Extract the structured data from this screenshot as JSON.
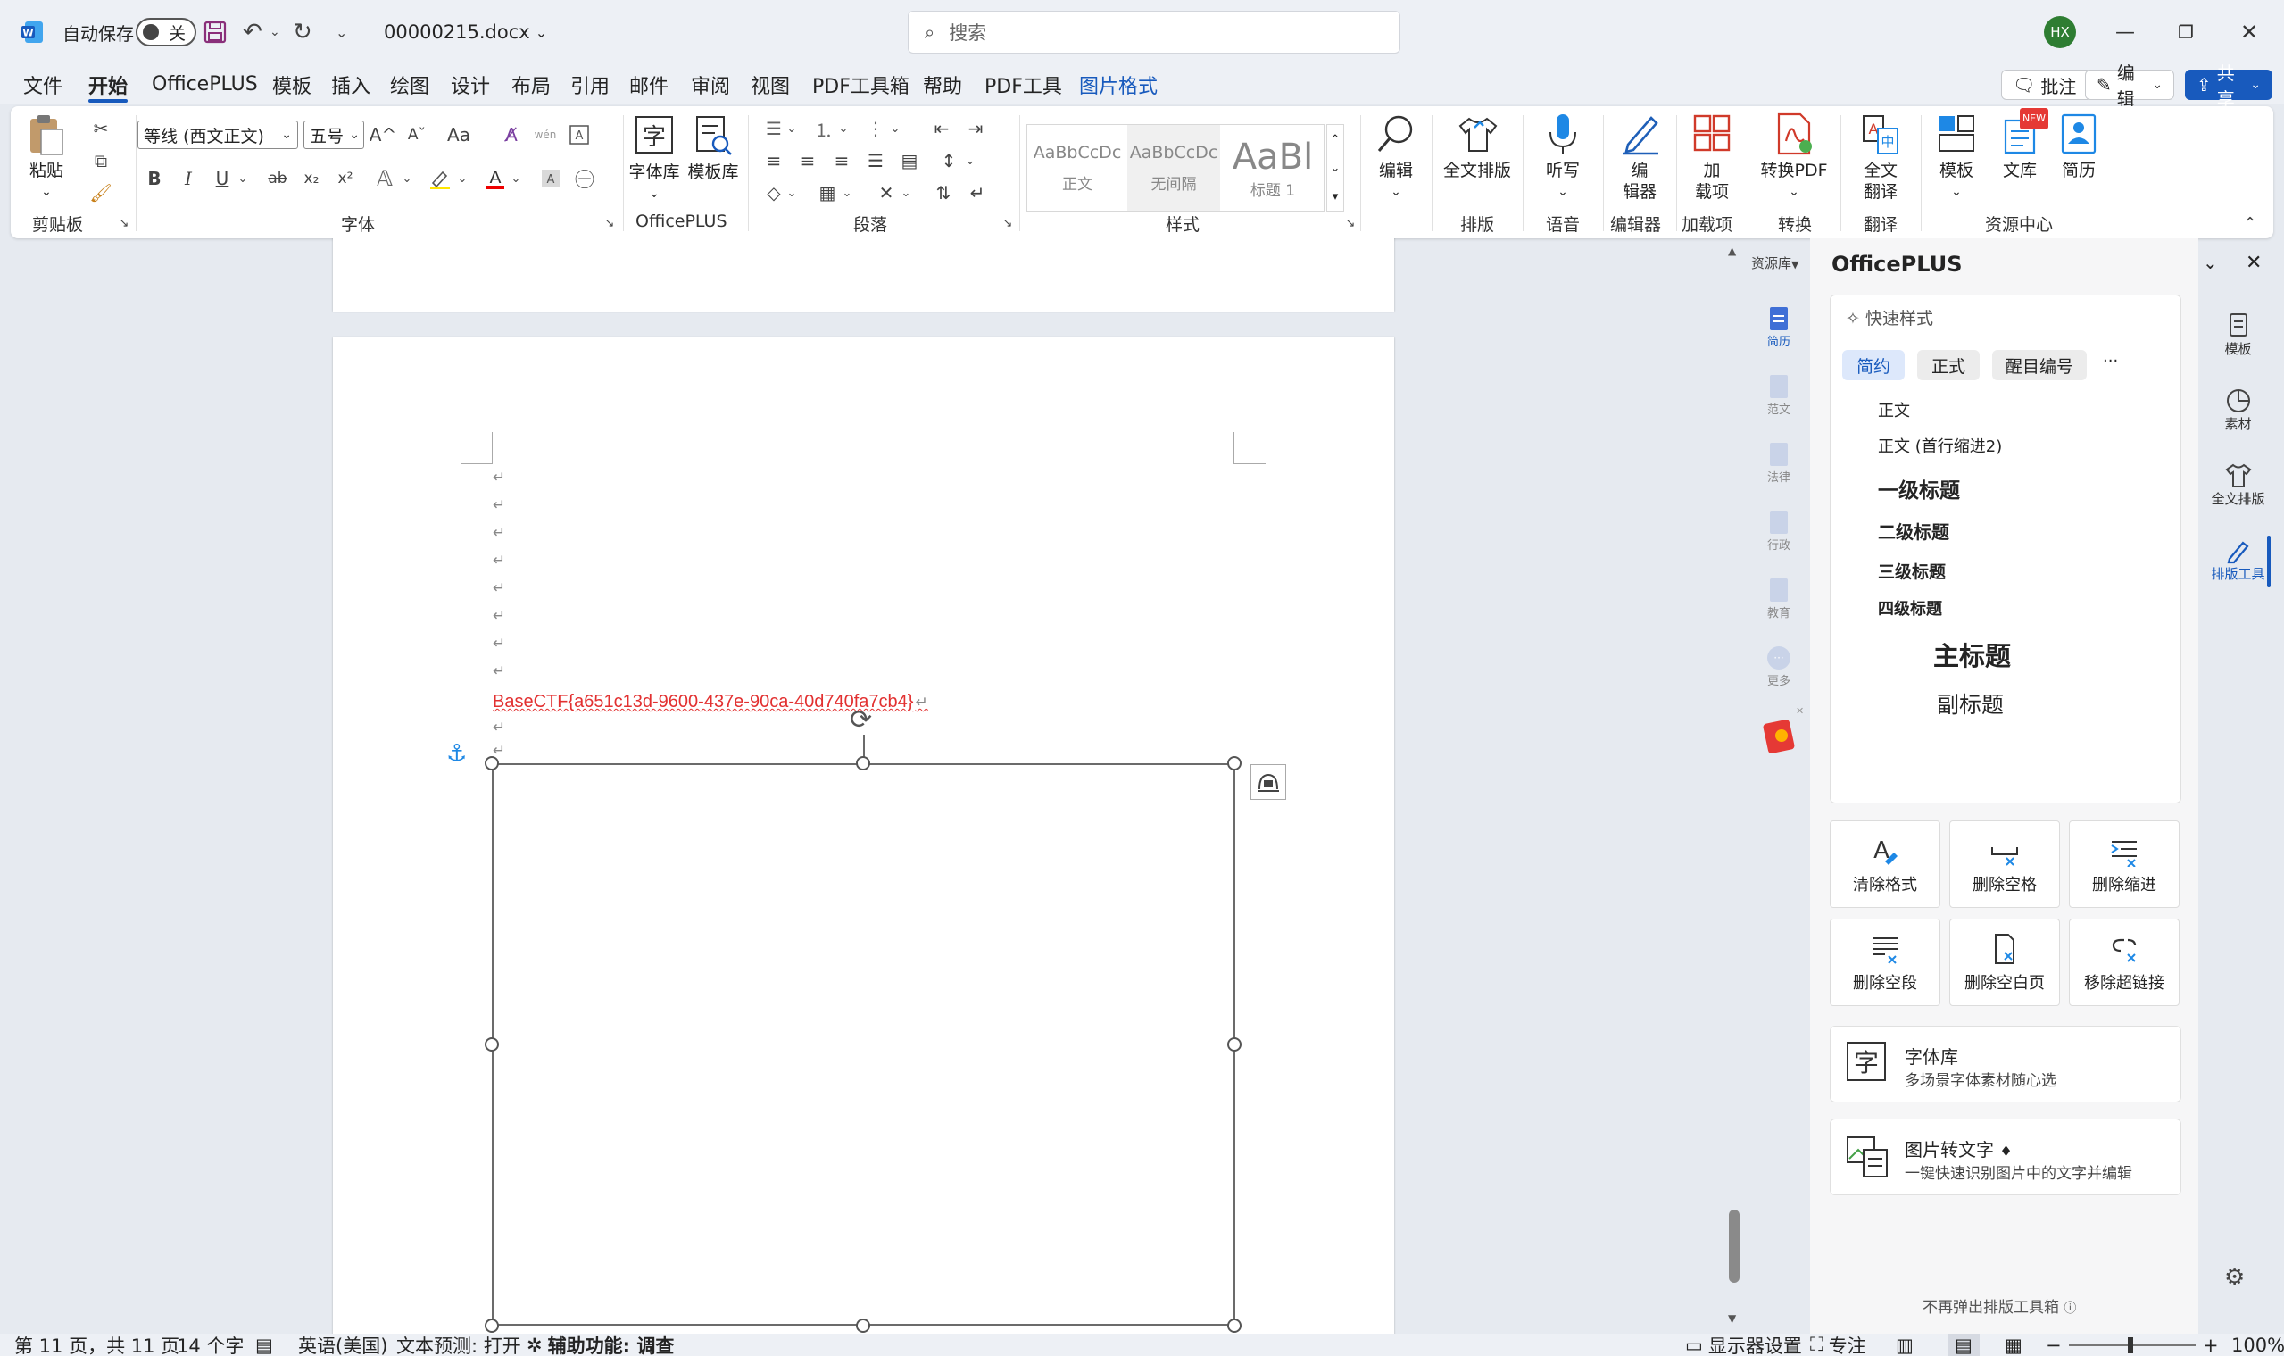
{
  "titlebar": {
    "autosave_label": "自动保存",
    "autosave_state": "关",
    "filename": "00000215.docx",
    "search_placeholder": "搜索",
    "avatar_initials": "HX",
    "accent": "#185abd",
    "avatar_color": "#2e7d32"
  },
  "menu": {
    "items": [
      "文件",
      "开始",
      "OfficePLUS",
      "模板",
      "插入",
      "绘图",
      "设计",
      "布局",
      "引用",
      "邮件",
      "审阅",
      "视图",
      "PDF工具箱",
      "帮助",
      "PDF工具",
      "图片格式"
    ],
    "active": "开始",
    "comment_button": "批注",
    "edit_button": "编辑",
    "share_button": "共享"
  },
  "ribbon": {
    "clipboard": {
      "paste": "粘贴",
      "group": "剪贴板"
    },
    "font": {
      "font_name": "等线 (西文正文)",
      "font_size": "五号",
      "group": "字体",
      "bold": "B",
      "italic": "I",
      "underline": "U",
      "strike": "ab",
      "sub": "x₂",
      "sup": "x²",
      "grow": "A^",
      "shrink": "Aˇ",
      "case": "Aa"
    },
    "officeplus": {
      "font_lib": "字体库",
      "template_lib": "模板库",
      "group": "OfficePLUS"
    },
    "paragraph": {
      "group": "段落"
    },
    "styles": {
      "normal": "正文",
      "no_spacing": "无间隔",
      "heading1": "标题 1",
      "sample": "AaBbCcDc",
      "sample_big": "AaBl",
      "group": "样式"
    },
    "editing": {
      "label": "编辑"
    },
    "layout": {
      "label": "全文排版",
      "group": "排版"
    },
    "voice": {
      "label": "听写",
      "group": "语音"
    },
    "editor": {
      "label1": "编",
      "label2": "辑器",
      "group": "编辑器"
    },
    "addins": {
      "label1": "加",
      "label2": "载项",
      "group": "加载项"
    },
    "convert": {
      "label": "转换PDF",
      "group": "转换"
    },
    "translate": {
      "label1": "全文",
      "label2": "翻译",
      "group": "翻译"
    },
    "resources": {
      "template": "模板",
      "library": "文库",
      "resume": "简历",
      "new_badge": "NEW",
      "group": "资源中心"
    }
  },
  "document": {
    "flag_text": "BaseCTF{a651c13d-9600-437e-90ca-40d740fa7cb4}",
    "para_mark": "↵"
  },
  "sidestrip": {
    "header": "资源库",
    "items": [
      "简历",
      "范文",
      "法律",
      "行政",
      "教育",
      "更多"
    ]
  },
  "pane": {
    "title": "OfficePLUS",
    "quick_style": "快速样式",
    "chips": [
      "简约",
      "正式",
      "醒目编号"
    ],
    "more": "···",
    "styles": [
      "正文",
      "正文 (首行缩进2)",
      "一级标题",
      "二级标题",
      "三级标题",
      "四级标题",
      "主标题",
      "副标题"
    ],
    "tools": [
      "清除格式",
      "删除空格",
      "删除缩进",
      "删除空段",
      "删除空白页",
      "移除超链接"
    ],
    "font_lib_title": "字体库",
    "font_lib_desc": "多场景字体素材随心选",
    "ocr_title": "图片转文字",
    "ocr_desc": "一键快速识别图片中的文字并编辑",
    "footer": "不再弹出排版工具箱"
  },
  "right_tabs": [
    "模板",
    "素材",
    "全文排版",
    "排版工具"
  ],
  "status": {
    "page": "第 11 页，共 11 页",
    "words": "14 个字",
    "language": "英语(美国)",
    "predict": "文本预测: 打开",
    "accessibility": "辅助功能: 调查",
    "display": "显示器设置",
    "focus": "专注",
    "zoom": "100%"
  }
}
